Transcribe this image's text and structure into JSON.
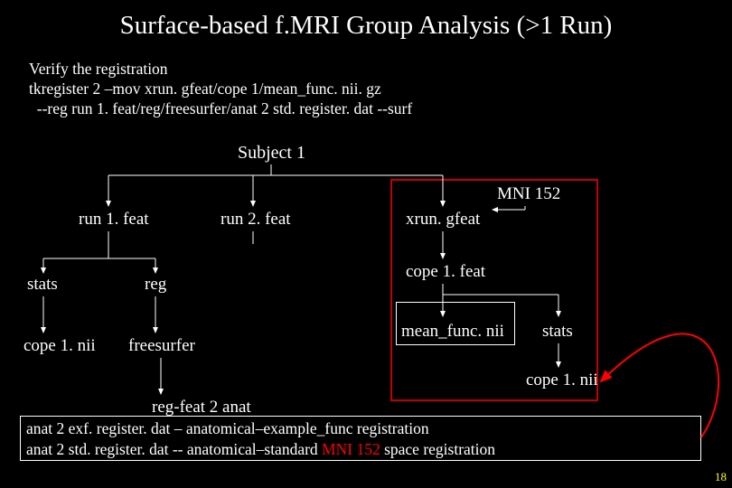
{
  "title": "Surface-based f.MRI Group Analysis (>1 Run)",
  "subtitle": {
    "line1": "Verify the registration",
    "line2": "tkregister 2 –mov xrun. gfeat/cope 1/mean_func. nii. gz",
    "line3": "  --reg run 1. feat/reg/freesurfer/anat 2 std. register. dat --surf"
  },
  "nodes": {
    "subject1": "Subject 1",
    "mni152": "MNI 152",
    "run1": "run 1. feat",
    "run2": "run 2. feat",
    "xrun": "xrun. gfeat",
    "cope1feat": "cope 1. feat",
    "stats": "stats",
    "reg": "reg",
    "meanfunc": "mean_func. nii",
    "stats2": "stats",
    "cope1nii": "cope 1. nii",
    "freesurfer": "freesurfer",
    "cope1nii2": "cope 1. nii",
    "regfeat2anat": "reg-feat 2 anat"
  },
  "bottom": {
    "line1_a": "anat 2 exf. register. dat – anatomical–example_func registration",
    "line2_a": "anat 2 std. register. dat -- anatomical–standard ",
    "line2_mni": "MNI 152",
    "line2_b": " space registration"
  },
  "page": "18"
}
